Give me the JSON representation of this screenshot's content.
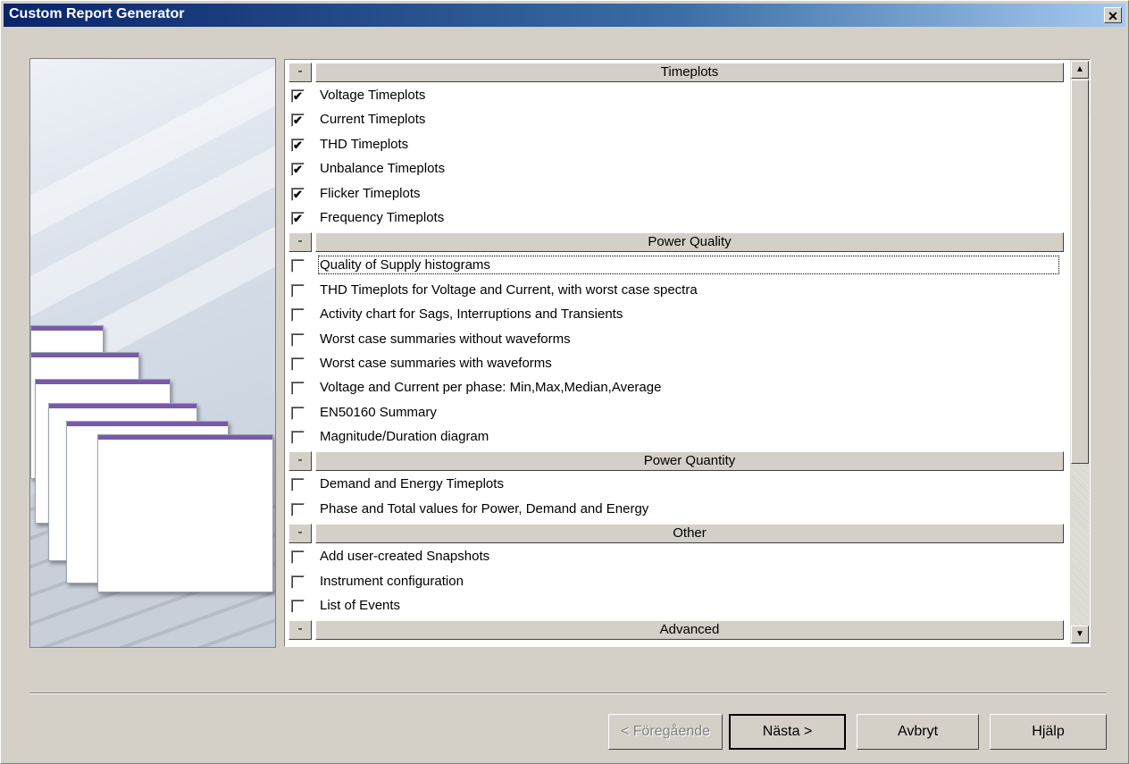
{
  "window": {
    "title": "Custom Report Generator",
    "close_glyph": "✕"
  },
  "groups": [
    {
      "id": "timeplots",
      "collapse_label": "-",
      "title": "Timeplots",
      "items": [
        {
          "label": "Voltage Timeplots",
          "checked": true
        },
        {
          "label": "Current Timeplots",
          "checked": true
        },
        {
          "label": "THD Timeplots",
          "checked": true
        },
        {
          "label": "Unbalance Timeplots",
          "checked": true
        },
        {
          "label": "Flicker Timeplots",
          "checked": true
        },
        {
          "label": "Frequency Timeplots",
          "checked": true
        }
      ]
    },
    {
      "id": "power-quality",
      "collapse_label": "-",
      "title": "Power Quality",
      "items": [
        {
          "label": "Quality of Supply histograms",
          "checked": false,
          "focused": true
        },
        {
          "label": "THD Timeplots for Voltage and Current, with worst case spectra",
          "checked": false
        },
        {
          "label": "Activity chart for Sags, Interruptions and Transients",
          "checked": false
        },
        {
          "label": "Worst case summaries without waveforms",
          "checked": false
        },
        {
          "label": "Worst case summaries with waveforms",
          "checked": false
        },
        {
          "label": "Voltage and Current per phase: Min,Max,Median,Average",
          "checked": false
        },
        {
          "label": "EN50160 Summary",
          "checked": false
        },
        {
          "label": "Magnitude/Duration diagram",
          "checked": false
        }
      ]
    },
    {
      "id": "power-quantity",
      "collapse_label": "-",
      "title": "Power Quantity",
      "items": [
        {
          "label": "Demand and Energy Timeplots",
          "checked": false
        },
        {
          "label": "Phase and Total values for Power, Demand and Energy",
          "checked": false
        }
      ]
    },
    {
      "id": "other",
      "collapse_label": "-",
      "title": "Other",
      "items": [
        {
          "label": "Add user-created Snapshots",
          "checked": false
        },
        {
          "label": "Instrument configuration",
          "checked": false
        },
        {
          "label": "List of Events",
          "checked": false
        }
      ]
    },
    {
      "id": "advanced",
      "collapse_label": "-",
      "title": "Advanced",
      "items": []
    }
  ],
  "scrollbar": {
    "up_icon": "▲",
    "down_icon": "▼"
  },
  "check_glyph": "✔",
  "buttons": {
    "back": "< Föregående",
    "next": "Nästa >",
    "cancel": "Avbryt",
    "help": "Hjälp"
  }
}
